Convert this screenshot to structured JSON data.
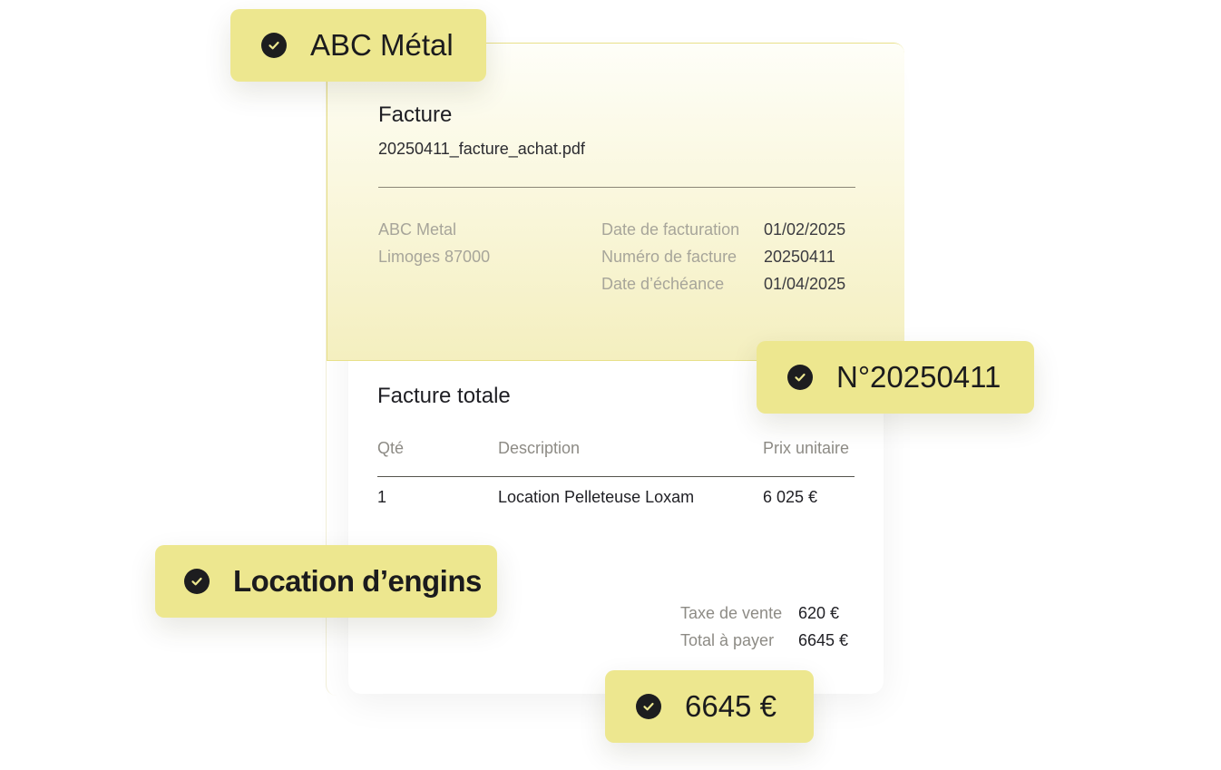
{
  "invoice": {
    "title": "Facture",
    "filename": "20250411_facture_achat.pdf",
    "supplier": {
      "name": "ABC Metal",
      "city": "Limoges 87000"
    },
    "meta": [
      {
        "label": "Date de facturation",
        "value": "01/02/2025"
      },
      {
        "label": "Numéro de facture",
        "value": "20250411"
      },
      {
        "label": "Date d’échéance",
        "value": "01/04/2025"
      }
    ],
    "total_title": "Facture totale",
    "columns": {
      "qty": "Qté",
      "description": "Description",
      "unit_price": "Prix unitaire"
    },
    "rows": [
      {
        "qty": "1",
        "description": "Location Pelleteuse Loxam",
        "unit_price": "6 025 €"
      }
    ],
    "summary": [
      {
        "label": "Taxe de vente",
        "value": "620 €"
      },
      {
        "label": "Total à payer",
        "value": "6645 €"
      }
    ]
  },
  "tags": {
    "supplier": "ABC Métal",
    "number": "N°20250411",
    "category": "Location d’engins",
    "amount": "6645 €"
  },
  "colors": {
    "tag_bg": "#ede78f",
    "card_gradient_top": "#fefef8",
    "card_gradient_bottom": "#f4efbf",
    "check_bg": "#1d1d1f"
  }
}
